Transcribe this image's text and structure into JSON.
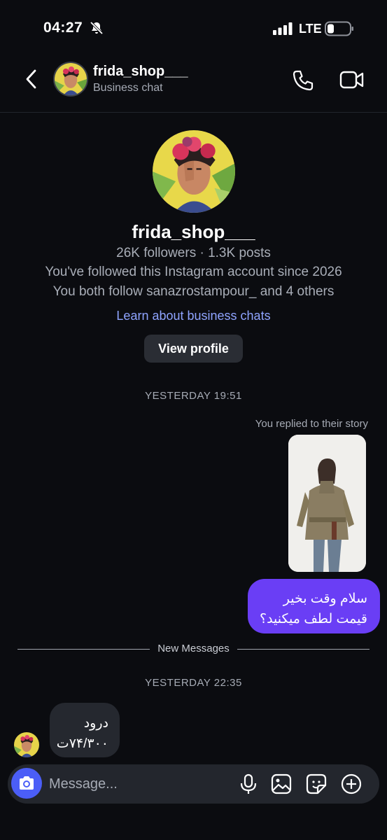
{
  "status_bar": {
    "time": "04:27",
    "network": "LTE"
  },
  "header": {
    "username": "frida_shop___",
    "subtitle": "Business chat"
  },
  "profile": {
    "username": "frida_shop___",
    "stats": "26K followers · 1.3K posts",
    "followed_since": "You've followed this Instagram account since 2026",
    "mutuals": "You both follow sanazrostampour_ and 4 others",
    "learn_link": "Learn about business chats",
    "view_profile_label": "View profile"
  },
  "conversation": {
    "timestamp_1": "YESTERDAY 19:51",
    "story_reply_label": "You replied to their story",
    "sent_message_line1": "سلام وقت بخیر",
    "sent_message_line2": "قیمت لطف میکنید؟",
    "new_messages_label": "New Messages",
    "timestamp_2": "YESTERDAY 22:35",
    "received_message_line1": "درود",
    "received_message_line2": "۷۴/۳۰۰ت"
  },
  "composer": {
    "placeholder": "Message..."
  },
  "colors": {
    "accent": "#4b5ef7",
    "sent_bubble": "#6a3ef5",
    "received_bubble": "#25282f",
    "link": "#8fa4ff"
  },
  "icons": [
    "bell-muted-icon",
    "signal-icon",
    "battery-icon",
    "back-chevron-icon",
    "phone-icon",
    "video-camera-icon",
    "camera-icon",
    "microphone-icon",
    "gallery-icon",
    "sticker-icon",
    "plus-circle-icon"
  ]
}
